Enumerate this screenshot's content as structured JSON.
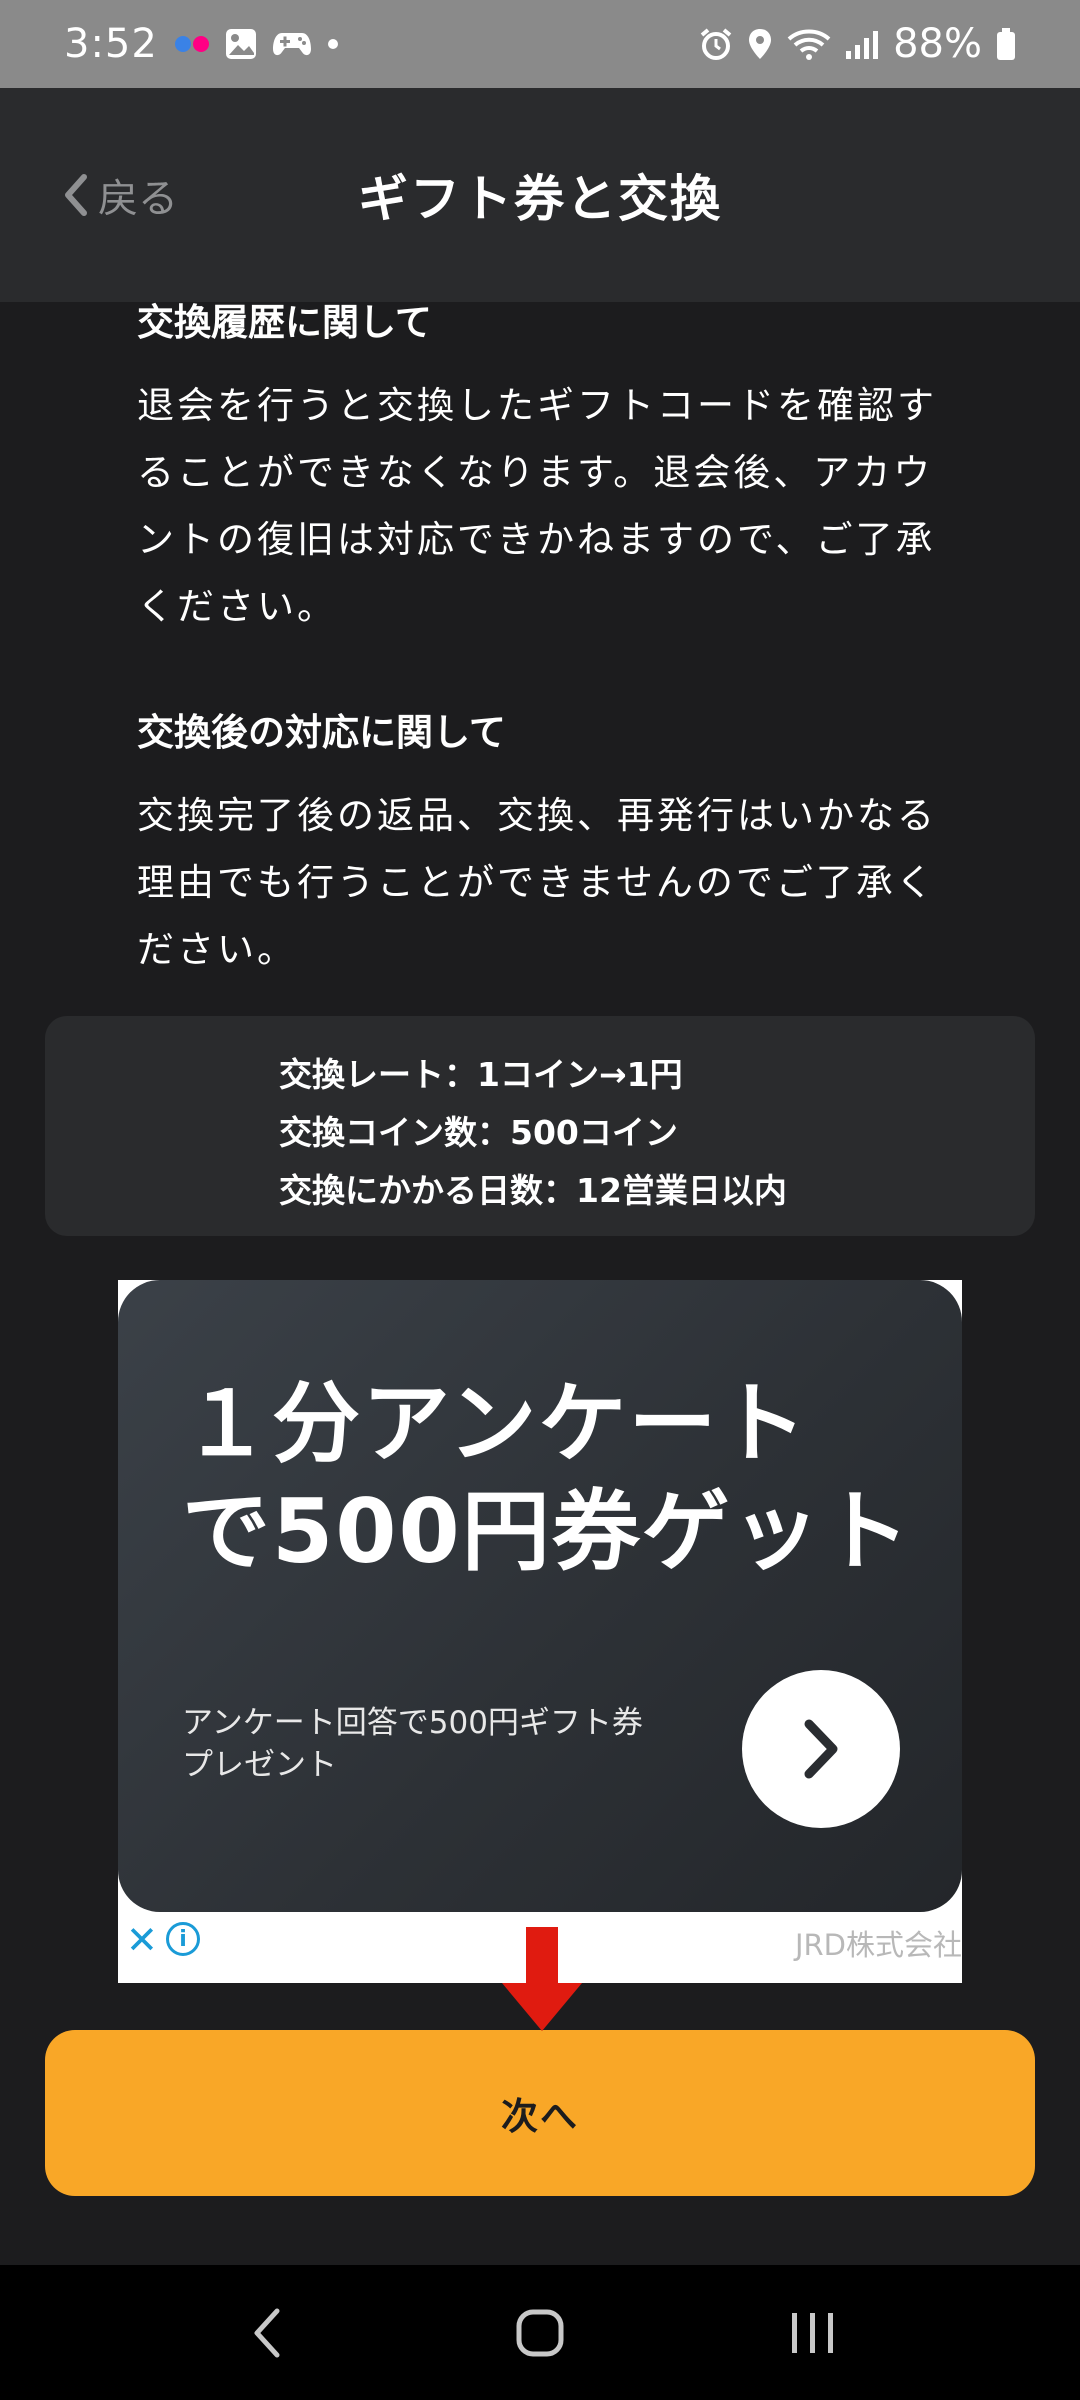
{
  "status_bar": {
    "time": "3:52",
    "battery": "88%"
  },
  "header": {
    "back_label": "戻る",
    "title": "ギフト券と交換"
  },
  "sections": [
    {
      "title": "交換履歴に関して",
      "body": "退会を行うと交換したギフトコードを確認することができなくなります。退会後、アカウントの復旧は対応できかねますので、ご了承ください。"
    },
    {
      "title": "交換後の対応に関して",
      "body": "交換完了後の返品、交換、再発行はいかなる理由でも行うことができませんのでご了承ください。"
    }
  ],
  "rate_info": {
    "rate": "交換レート：1コイン→1円",
    "coins": "交換コイン数：500コイン",
    "days": "交換にかかる日数：12営業日以内"
  },
  "ad": {
    "headline_line1": "１分アンケート",
    "headline_line2": "で500円券ゲット",
    "sub_line1": "アンケート回答で500円ギフト券",
    "sub_line2": "プレゼント",
    "sponsor": "JRD株式会社",
    "close_symbol": "✕",
    "info_symbol": "i"
  },
  "next_button": {
    "label": "次へ"
  },
  "colors": {
    "accent": "#f9a727",
    "background": "#1c1c1e",
    "header": "#2a2b2d",
    "annotation": "#e01b10"
  }
}
